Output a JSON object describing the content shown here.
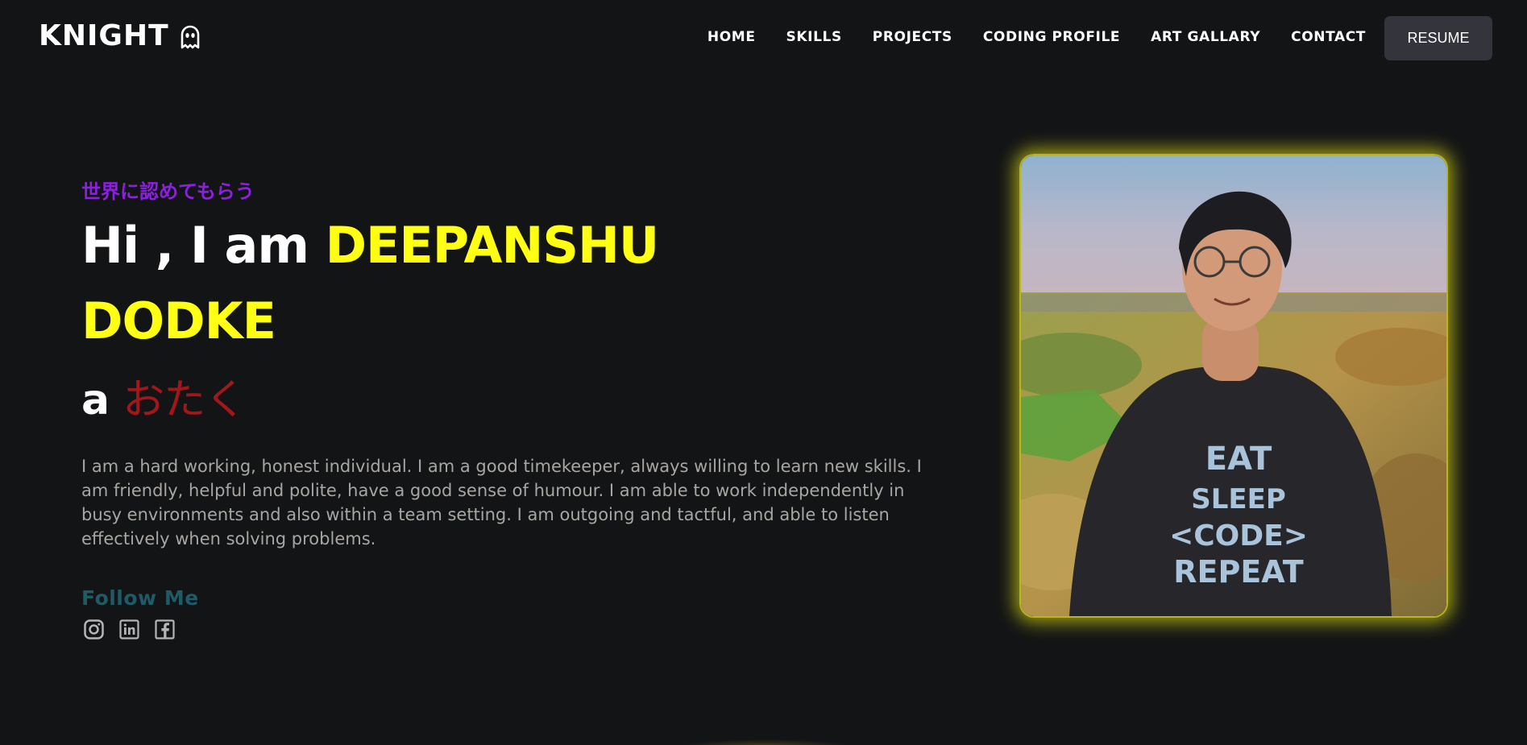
{
  "brand": {
    "name": "KNIGHT",
    "icon": "ghost-icon"
  },
  "nav": {
    "items": [
      {
        "label": "HOME"
      },
      {
        "label": "SKILLS"
      },
      {
        "label": "PROJECTS"
      },
      {
        "label": "CODING PROFILE"
      },
      {
        "label": "ART GALLARY"
      },
      {
        "label": "CONTACT"
      }
    ],
    "resume_label": "RESUME"
  },
  "hero": {
    "tagline": "世界に認めてもらう",
    "greeting": "Hi , I am",
    "first_name": "DEEPANSHU",
    "last_name": "DODKE",
    "role_prefix": "a",
    "role": "おたく",
    "about": "I am a hard working, honest individual. I am a good timekeeper, always willing to learn new skills. I am friendly, helpful and polite, have a good sense of humour. I am able to work independently in busy environments and also within a team setting. I am outgoing and tactful, and able to listen effectively when solving problems.",
    "follow_label": "Follow Me",
    "socials": [
      {
        "icon": "instagram-icon"
      },
      {
        "icon": "linkedin-icon"
      },
      {
        "icon": "facebook-icon"
      }
    ]
  },
  "photo": {
    "shirt_text": [
      "EAT",
      "SLEEP",
      "<CODE>",
      "REPEAT"
    ]
  },
  "colors": {
    "background": "#131416",
    "accent_yellow": "#ffff14",
    "tagline_purple": "#8b20e0",
    "role_red": "#a3161a",
    "follow_teal": "#1e5b66",
    "resume_bg": "#33343c"
  }
}
